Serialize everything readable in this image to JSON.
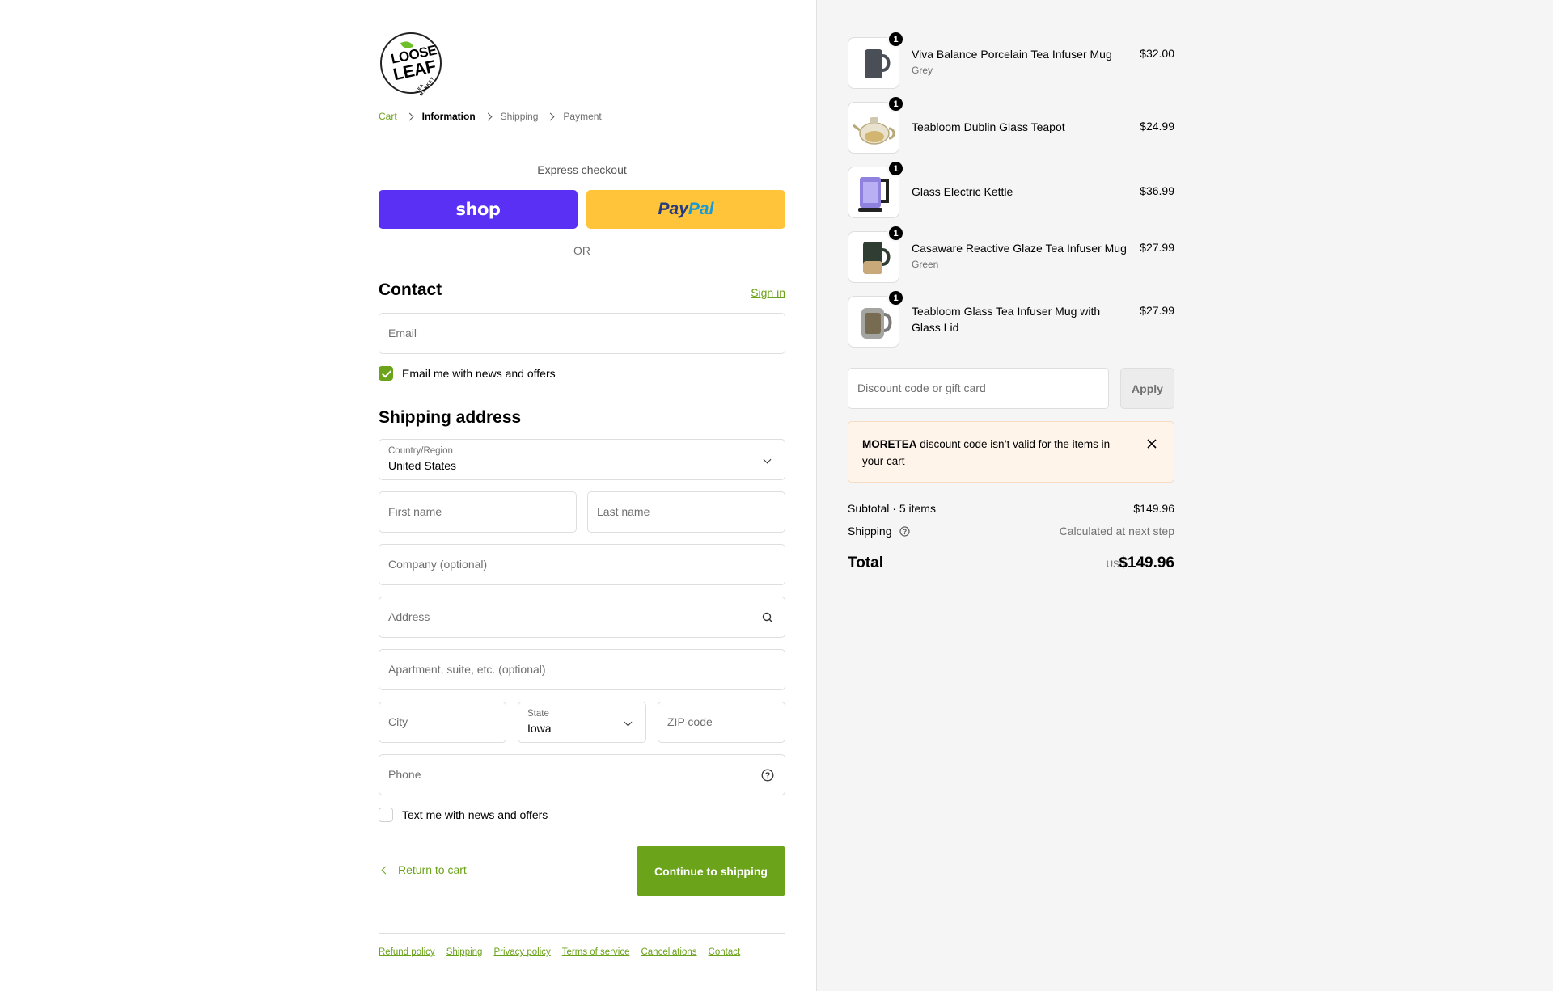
{
  "logo": {
    "line1": "LOOSE",
    "line2": "LEAF",
    "line3": "TEA MARKET"
  },
  "breadcrumb": {
    "cart": "Cart",
    "information": "Information",
    "shipping": "Shipping",
    "payment": "Payment"
  },
  "express": {
    "title": "Express checkout",
    "shop_label": "shop",
    "paypal_part1": "Pay",
    "paypal_part2": "Pal",
    "or": "OR"
  },
  "contact": {
    "title": "Contact",
    "signin": "Sign in",
    "email_placeholder": "Email",
    "news_label": "Email me with news and offers",
    "news_checked": true
  },
  "shipping": {
    "title": "Shipping address",
    "country_label": "Country/Region",
    "country_value": "United States",
    "first_name": "First name",
    "last_name": "Last name",
    "company": "Company (optional)",
    "address": "Address",
    "apartment": "Apartment, suite, etc. (optional)",
    "city": "City",
    "state_label": "State",
    "state_value": "Iowa",
    "zip": "ZIP code",
    "phone": "Phone",
    "text_label": "Text me with news and offers",
    "text_checked": false
  },
  "actions": {
    "return": "Return to cart",
    "continue": "Continue to shipping"
  },
  "footer": {
    "links": [
      "Refund policy",
      "Shipping",
      "Privacy policy",
      "Terms of service",
      "Cancellations",
      "Contact"
    ]
  },
  "cart": {
    "items": [
      {
        "title": "Viva Balance Porcelain Tea Infuser Mug",
        "variant": "Grey",
        "price": "$32.00",
        "qty": "1"
      },
      {
        "title": "Teabloom Dublin Glass Teapot",
        "variant": "",
        "price": "$24.99",
        "qty": "1"
      },
      {
        "title": "Glass Electric Kettle",
        "variant": "",
        "price": "$36.99",
        "qty": "1"
      },
      {
        "title": "Casaware Reactive Glaze Tea Infuser Mug",
        "variant": "Green",
        "price": "$27.99",
        "qty": "1"
      },
      {
        "title": "Teabloom Glass Tea Infuser Mug with Glass Lid",
        "variant": "",
        "price": "$27.99",
        "qty": "1"
      }
    ],
    "discount_placeholder": "Discount code or gift card",
    "apply": "Apply",
    "notice_code": "MORETEA",
    "notice_text": " discount code isn’t valid for the items in your cart",
    "subtotal_label": "Subtotal · 5 items",
    "subtotal_value": "$149.96",
    "shipping_label": "Shipping",
    "shipping_value": "Calculated at next step",
    "total_label": "Total",
    "total_currency": "USD",
    "total_value": "$149.96"
  },
  "colors": {
    "accent": "#6ba31b",
    "shop": "#5a31f4",
    "paypal": "#ffc439"
  }
}
